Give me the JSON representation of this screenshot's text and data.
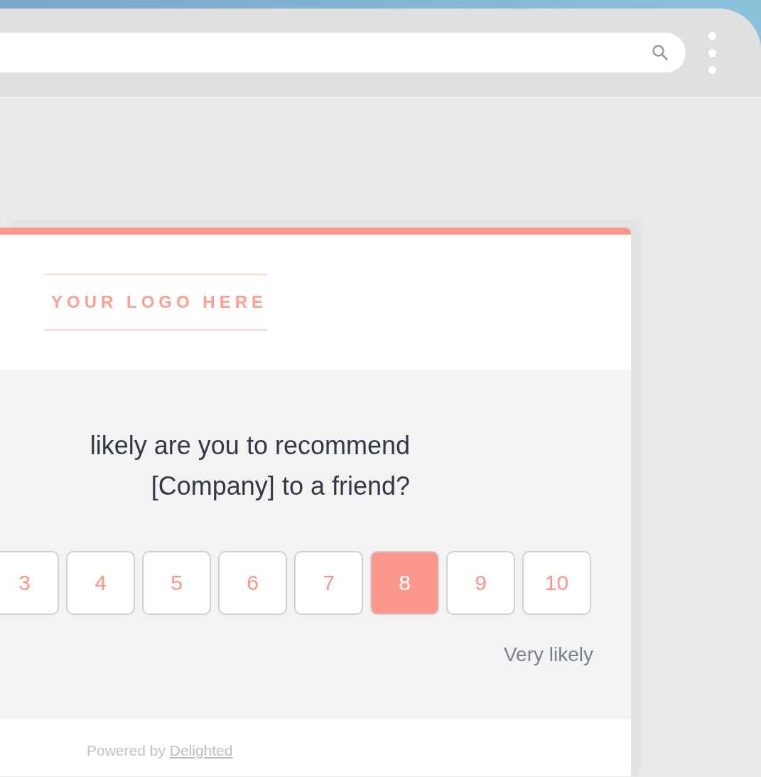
{
  "survey": {
    "logo_text": "YOUR LOGO HERE",
    "question": "likely are you to recommend\n[Company] to a friend?",
    "scale": [
      {
        "label": "3",
        "selected": false
      },
      {
        "label": "4",
        "selected": false
      },
      {
        "label": "5",
        "selected": false
      },
      {
        "label": "6",
        "selected": false
      },
      {
        "label": "7",
        "selected": false
      },
      {
        "label": "8",
        "selected": true
      },
      {
        "label": "9",
        "selected": false
      },
      {
        "label": "10",
        "selected": false
      }
    ],
    "high_label": "Very likely",
    "footer": {
      "text": "Powered by ",
      "link": "Delighted"
    }
  }
}
